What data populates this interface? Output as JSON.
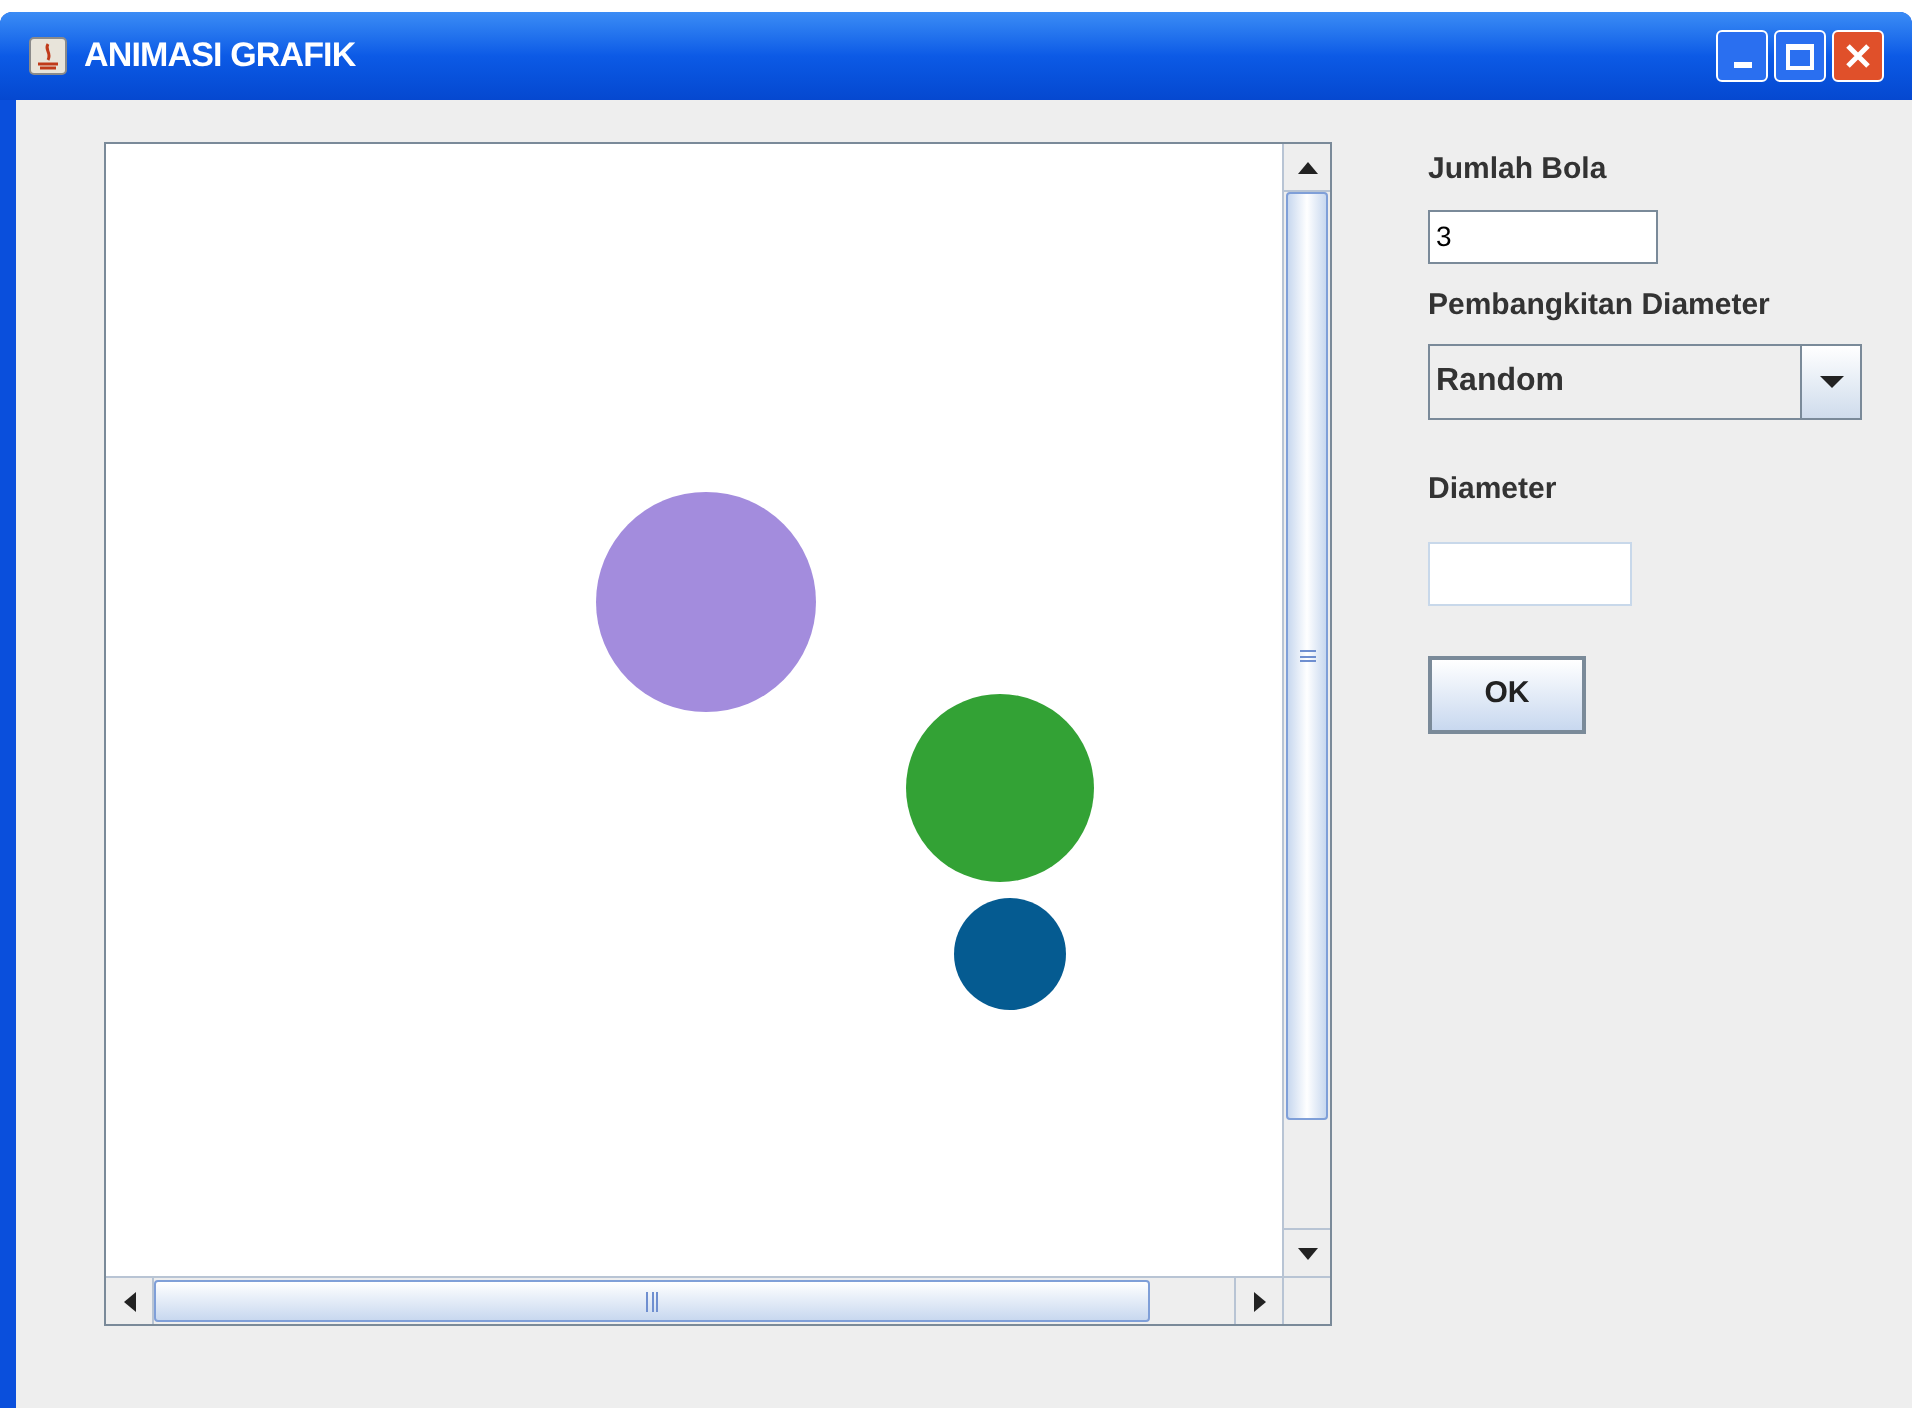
{
  "window": {
    "title": "ANIMASI GRAFIK"
  },
  "canvas": {
    "balls": [
      {
        "color": "#a38cdd"
      },
      {
        "color": "#33a235"
      },
      {
        "color": "#055b91"
      }
    ]
  },
  "panel": {
    "count_label": "Jumlah Bola",
    "count_value": "3",
    "mode_label": "Pembangkitan Diameter",
    "mode_value": "Random",
    "diameter_label": "Diameter",
    "diameter_field": {
      "disabled": true
    },
    "ok_button": "OK"
  }
}
